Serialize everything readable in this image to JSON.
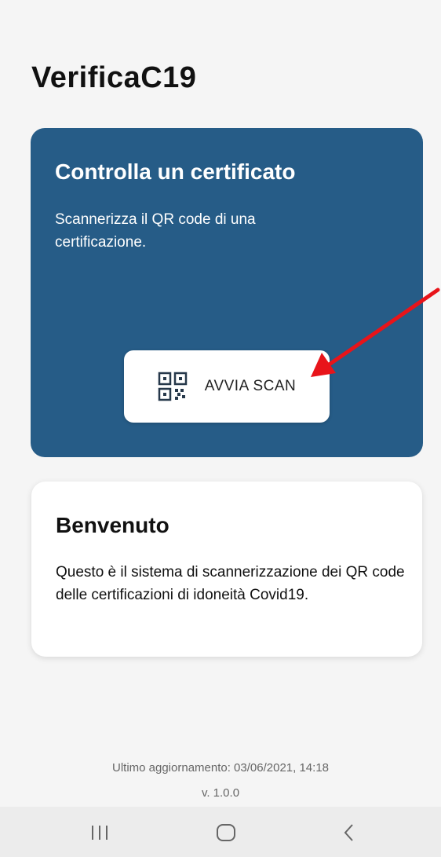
{
  "app": {
    "title": "VerificaC19"
  },
  "scan_card": {
    "title": "Controlla un certificato",
    "description": "Scannerizza il QR code di una certificazione.",
    "button_label": "AVVIA SCAN",
    "button_icon": "qr-code-icon",
    "background_color": "#265c87"
  },
  "annotation": {
    "arrow_color": "#e8141a",
    "arrow_icon": "red-arrow-icon"
  },
  "welcome_card": {
    "title": "Benvenuto",
    "description": "Questo è il sistema di scannerizzazione dei QR code delle certificazioni di idoneità Covid19."
  },
  "footer": {
    "last_update": "Ultimo aggiornamento: 03/06/2021, 14:18",
    "version": "v. 1.0.0"
  },
  "navbar": {
    "buttons": [
      "recent-apps-icon",
      "home-icon",
      "back-icon"
    ]
  }
}
